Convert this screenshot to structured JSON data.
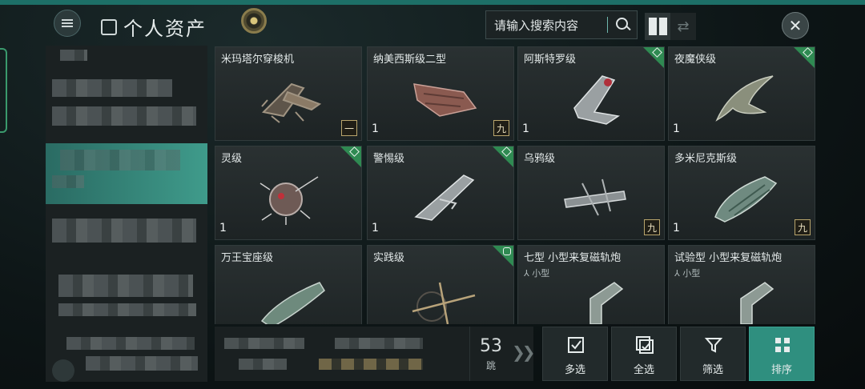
{
  "header": {
    "title": "个人资产",
    "search_placeholder": "请输入搜索内容",
    "close_glyph": "✕",
    "swap_glyph": "⇄",
    "icons": [
      "menu-icon",
      "asset-icon",
      "gold-emblem-icon",
      "search-icon",
      "grid-view-icon",
      "swap-view-icon",
      "close-icon"
    ]
  },
  "categories": {
    "active_index": 1,
    "count": 5
  },
  "items": [
    {
      "name": "米玛塔尔穿梭机",
      "sub": "",
      "count": "",
      "badge": "一",
      "corner": "",
      "hull": "#7a6e5c"
    },
    {
      "name": "纳美西斯级二型",
      "sub": "",
      "count": "1",
      "badge": "九",
      "corner": "",
      "hull": "#8a5a50"
    },
    {
      "name": "阿斯特罗级",
      "sub": "",
      "count": "1",
      "badge": "",
      "corner": "diamond",
      "hull": "#9aa0a2"
    },
    {
      "name": "夜魔侠级",
      "sub": "",
      "count": "1",
      "badge": "",
      "corner": "diamond",
      "hull": "#8a8f7c"
    },
    {
      "name": "灵级",
      "sub": "",
      "count": "1",
      "badge": "",
      "corner": "diamond",
      "hull": "#7a5e58"
    },
    {
      "name": "警惕级",
      "sub": "",
      "count": "1",
      "badge": "",
      "corner": "diamond",
      "hull": "#9aa0a2"
    },
    {
      "name": "乌鸦级",
      "sub": "",
      "count": "",
      "badge": "九",
      "corner": "",
      "hull": "#8b9193"
    },
    {
      "name": "多米尼克斯级",
      "sub": "",
      "count": "1",
      "badge": "九",
      "corner": "",
      "hull": "#6f8a80"
    },
    {
      "name": "万王宝座级",
      "sub": "",
      "count": "",
      "badge": "",
      "corner": "",
      "hull": "#6e8a7d"
    },
    {
      "name": "实践级",
      "sub": "",
      "count": "",
      "badge": "",
      "corner": "ring",
      "hull": "#8e7d5c"
    },
    {
      "name": "七型 小型来复磁轨炮",
      "sub": "小型",
      "count": "",
      "badge": "",
      "corner": "",
      "hull": "#8d9a94"
    },
    {
      "name": "试验型 小型来复磁轨炮",
      "sub": "小型",
      "count": "",
      "badge": "",
      "corner": "",
      "hull": "#8d9a94"
    }
  ],
  "bottom": {
    "jumps": "53",
    "jumps_label": "跳",
    "jump_arrow": "❯❯"
  },
  "actions": [
    {
      "label": "多选",
      "icon": "multi-select-icon",
      "primary": false
    },
    {
      "label": "全选",
      "icon": "select-all-icon",
      "primary": false
    },
    {
      "label": "筛选",
      "icon": "filter-icon",
      "primary": false
    },
    {
      "label": "排序",
      "icon": "sort-icon",
      "primary": true
    }
  ],
  "colors": {
    "accent": "#2f8f7f",
    "corner_green": "#2f8a52",
    "badge_gold": "#b9a56c"
  }
}
